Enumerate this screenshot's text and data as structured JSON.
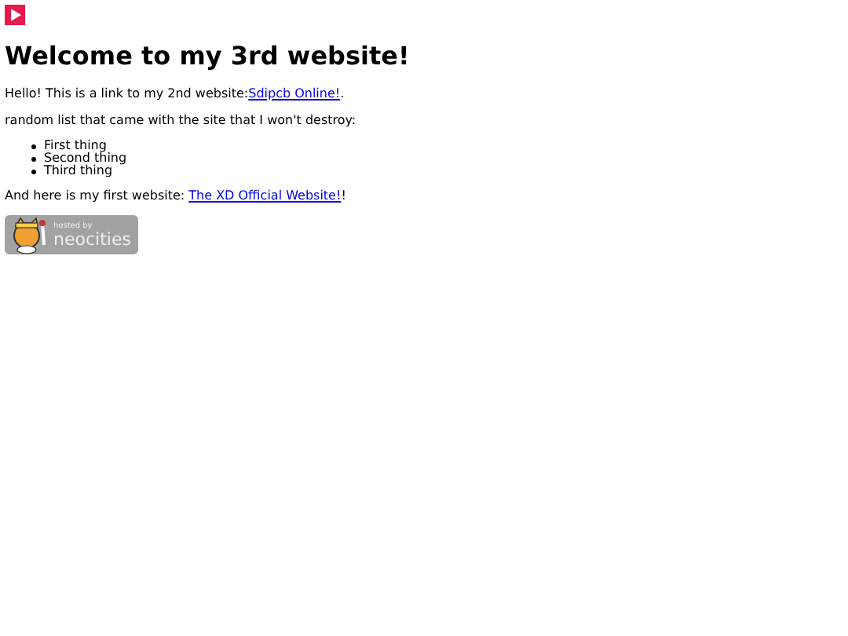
{
  "heading": "Welcome to my 3rd website!",
  "intro": {
    "text": "Hello! This is a link to my 2nd website:",
    "link": "Sdipcb Online!",
    "after": "."
  },
  "list_intro": "random list that came with the site that I won't destroy:",
  "list": [
    "First thing",
    "Second thing",
    "Third thing"
  ],
  "outro": {
    "text": "And here is my first website: ",
    "link": "The XD Official Website!",
    "after": "!"
  },
  "badge": {
    "small": "hosted by",
    "big": "neocities"
  }
}
